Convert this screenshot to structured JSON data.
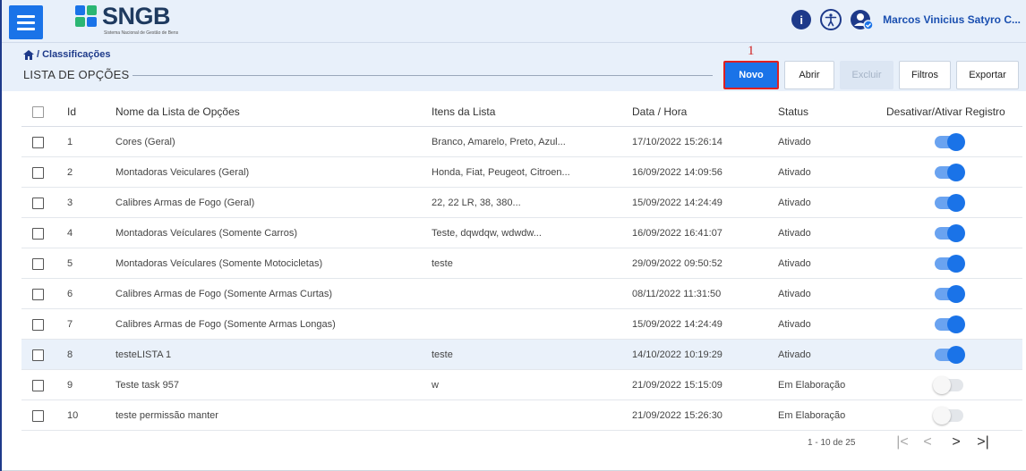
{
  "app": {
    "logo_text": "SNGB",
    "logo_subtitle": "Sistema Nacional de Gestão de Bens",
    "user_name": "Marcos Vinicius Satyro C..."
  },
  "breadcrumb": {
    "separator": "/",
    "current": "Classificações"
  },
  "page": {
    "title": "LISTA DE OPÇÕES"
  },
  "toolbar": {
    "marker": "1",
    "new_label": "Novo",
    "open_label": "Abrir",
    "delete_label": "Excluir",
    "filters_label": "Filtros",
    "export_label": "Exportar"
  },
  "table": {
    "columns": {
      "id": "Id",
      "name": "Nome da Lista de Opções",
      "items": "Itens da Lista",
      "datetime": "Data / Hora",
      "status": "Status",
      "toggle": "Desativar/Ativar Registro"
    },
    "rows": [
      {
        "id": "1",
        "name": "Cores (Geral)",
        "items": "Branco, Amarelo, Preto, Azul...",
        "datetime": "17/10/2022 15:26:14",
        "status": "Ativado",
        "active": true,
        "highlight": false
      },
      {
        "id": "2",
        "name": "Montadoras Veiculares (Geral)",
        "items": "Honda, Fiat, Peugeot, Citroen...",
        "datetime": "16/09/2022 14:09:56",
        "status": "Ativado",
        "active": true,
        "highlight": false
      },
      {
        "id": "3",
        "name": "Calibres Armas de Fogo (Geral)",
        "items": "22, 22 LR, 38, 380...",
        "datetime": "15/09/2022 14:24:49",
        "status": "Ativado",
        "active": true,
        "highlight": false
      },
      {
        "id": "4",
        "name": "Montadoras Veículares (Somente Carros)",
        "items": "Teste, dqwdqw, wdwdw...",
        "datetime": "16/09/2022 16:41:07",
        "status": "Ativado",
        "active": true,
        "highlight": false
      },
      {
        "id": "5",
        "name": "Montadoras Veículares (Somente Motocicletas)",
        "items": "teste",
        "datetime": "29/09/2022 09:50:52",
        "status": "Ativado",
        "active": true,
        "highlight": false
      },
      {
        "id": "6",
        "name": "Calibres Armas de Fogo (Somente Armas Curtas)",
        "items": "",
        "datetime": "08/11/2022 11:31:50",
        "status": "Ativado",
        "active": true,
        "highlight": false
      },
      {
        "id": "7",
        "name": "Calibres Armas de Fogo (Somente Armas Longas)",
        "items": "",
        "datetime": "15/09/2022 14:24:49",
        "status": "Ativado",
        "active": true,
        "highlight": false
      },
      {
        "id": "8",
        "name": "testeLISTA 1",
        "items": "teste",
        "datetime": "14/10/2022 10:19:29",
        "status": "Ativado",
        "active": true,
        "highlight": true
      },
      {
        "id": "9",
        "name": "Teste task 957",
        "items": "w",
        "datetime": "21/09/2022 15:15:09",
        "status": "Em Elaboração",
        "active": false,
        "highlight": false
      },
      {
        "id": "10",
        "name": "teste permissão manter",
        "items": "",
        "datetime": "21/09/2022 15:26:30",
        "status": "Em Elaboração",
        "active": false,
        "highlight": false
      }
    ]
  },
  "pagination": {
    "range": "1 - 10 de 25",
    "first": "|<",
    "prev": "<",
    "next": ">",
    "last": ">|"
  },
  "colors": {
    "primary": "#1a73e8",
    "navy": "#1e3a8a",
    "header_bg": "#e8f0fa",
    "highlight_border": "#e02020"
  }
}
